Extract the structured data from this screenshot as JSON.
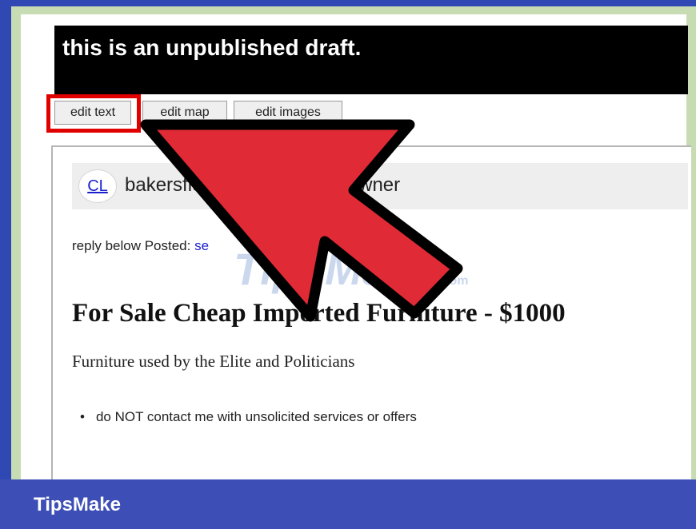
{
  "banner": {
    "text": "this is an unpublished draft."
  },
  "toolbar": {
    "edit_text_label": "edit text",
    "edit_map_label": "edit map",
    "edit_images_label": "edit images"
  },
  "header": {
    "logo_text": "CL",
    "breadcrumb": "bakersfield › furniture - by owner"
  },
  "post": {
    "reply_prefix": "reply below Posted:",
    "reply_link": "se",
    "title": "For Sale Cheap Imported Furniture - $1000",
    "subtitle": "Furniture used by the Elite and Politicians",
    "bullets": [
      "do NOT contact me with unsolicited services or offers"
    ]
  },
  "watermark": {
    "text": "TipsMake",
    "suffix": ".com"
  },
  "footer": {
    "brand": "TipsMake"
  },
  "colors": {
    "frame_blue": "#3d4fb7",
    "highlight_red": "#e00000",
    "arrow_red": "#e02a35",
    "link_blue": "#1a1fcc"
  },
  "icons": {
    "pointer": "arrow-pointer-icon",
    "logo": "cl-logo-icon"
  }
}
